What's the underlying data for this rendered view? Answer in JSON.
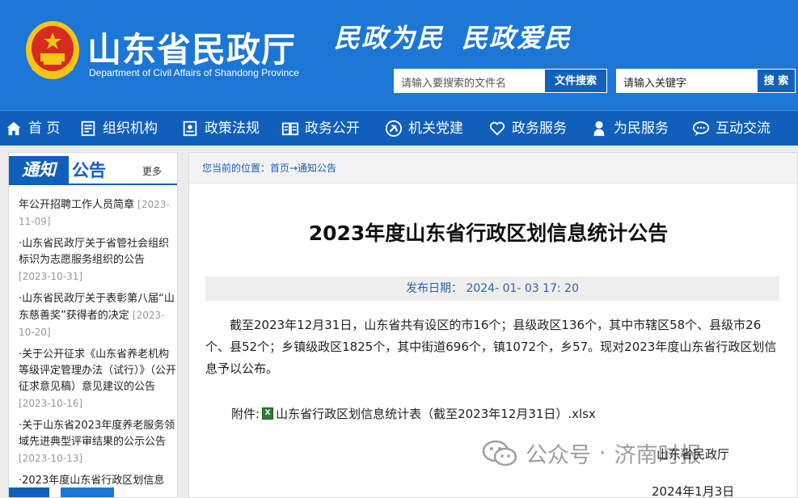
{
  "header": {
    "site_title": "山东省民政厅",
    "site_subtitle": "Department of Civil Affairs of Shandong Province",
    "slogan_1": "民政为民",
    "slogan_2": "民政爱民",
    "file_search_placeholder": "请输入要搜索的文件名",
    "file_search_button": "文件搜索",
    "keyword_search_placeholder": "请输入关键字",
    "keyword_search_button": "搜 索"
  },
  "nav": {
    "items": [
      {
        "label": "首 页",
        "icon": "home-icon"
      },
      {
        "label": "组织机构",
        "icon": "org-icon"
      },
      {
        "label": "政策法规",
        "icon": "policy-icon"
      },
      {
        "label": "政务公开",
        "icon": "book-icon"
      },
      {
        "label": "机关党建",
        "icon": "party-icon"
      },
      {
        "label": "政务服务",
        "icon": "heart-icon"
      },
      {
        "label": "为民服务",
        "icon": "person-icon"
      },
      {
        "label": "互动交流",
        "icon": "chat-icon"
      }
    ]
  },
  "sidebar": {
    "tag": "通知",
    "heading": "公告",
    "more": "更多",
    "items": [
      {
        "text": "年公开招聘工作人员简章",
        "date": "[2023-11-09]"
      },
      {
        "text": "·山东省民政厅关于省管社会组织标识为志愿服务组织的公告",
        "date": "[2023-10-31]"
      },
      {
        "text": "·山东省民政厅关于表彰第八届“山东慈善奖”获得者的决定",
        "date": "[2023-10-20]"
      },
      {
        "text": "·关于公开征求《山东省养老机构等级评定管理办法（试行）》（公开征求意见稿）意见建议的公告",
        "date": "[2023-10-16]"
      },
      {
        "text": "·关于山东省2023年度养老服务领域先进典型评审结果的公示公告",
        "date": "[2023-10-13]"
      },
      {
        "text": "·2023年度山东省行政区划信息",
        "date": ""
      }
    ]
  },
  "main": {
    "breadcrumb": "您当前的位置：首页→通知公告",
    "title": "2023年度山东省行政区划信息统计公告",
    "pub_date": "发布日期： 2024- 01- 03 17: 20",
    "body": "截至2023年12月31日，山东省共有设区的市16个；县级政区136个，其中市辖区58个、县级市26个、县52个；乡镇级政区1825个，其中街道696个，镇1072个，乡57。现对2023年度山东省行政区划信息予以公布。",
    "attachment_label": "附件:",
    "attachment_icon": "excel-file-icon",
    "attachment_name": "山东省行政区划信息统计表（截至2023年12月31日）.xlsx",
    "watermark_1": "公众号",
    "watermark_dot": "·",
    "watermark_2": "济南时报",
    "sign_org": "山东省民政厅",
    "sign_date": "2024年1月3日"
  },
  "colors": {
    "header_blue": "#1c76d6",
    "nav_blue": "#0f5fbb",
    "link_blue": "#2b62b5"
  }
}
